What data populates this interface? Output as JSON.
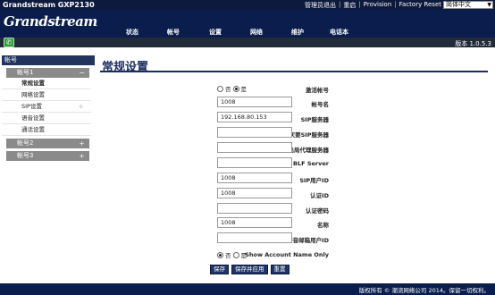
{
  "top": {
    "model": "Grandstream GXP2130",
    "links": [
      "管理员退出",
      "重启",
      "Provision",
      "Factory Reset"
    ],
    "language": "简体中文"
  },
  "logo": "Grandstream",
  "nav": [
    "状态",
    "帐号",
    "设置",
    "网络",
    "维护",
    "电话本"
  ],
  "version": "版本 1.0.5.3",
  "sidebar": {
    "header": "帐号",
    "account1": "帐号1",
    "account1_sign": "−",
    "subs": [
      "常规设置",
      "网络设置",
      "SIP设置",
      "语音设置",
      "通话设置"
    ],
    "account2": "帐号2",
    "account3": "帐号3",
    "plus": "+"
  },
  "page_title": "常规设置",
  "form": {
    "account_active": {
      "label": "激活帐号",
      "options": [
        "否",
        "是"
      ],
      "selected": "是"
    },
    "account_name": {
      "label": "帐号名",
      "value": "1008"
    },
    "sip_server": {
      "label": "SIP服务器",
      "value": "192.168.80.153"
    },
    "secondary_sip_server": {
      "label": "次要SIP服务器",
      "value": ""
    },
    "outbound_proxy": {
      "label": "出局代理服务器",
      "value": ""
    },
    "blf_server": {
      "label": "BLF Server",
      "value": ""
    },
    "sip_user_id": {
      "label": "SIP用户ID",
      "value": "1008"
    },
    "auth_id": {
      "label": "认证ID",
      "value": "1008"
    },
    "auth_password": {
      "label": "认证密码",
      "value": ""
    },
    "name": {
      "label": "名称",
      "value": "1008"
    },
    "voicemail_user_id": {
      "label": "语音邮箱用户ID",
      "value": ""
    },
    "show_account_name": {
      "label": "Show Account Name Only",
      "options": [
        "否",
        "是"
      ],
      "selected": "否"
    }
  },
  "buttons": {
    "save": "保存",
    "save_apply": "保存并应用",
    "reset": "重置"
  },
  "footer": "版权所有 © 潮流网络公司 2014。保留一切权利。"
}
